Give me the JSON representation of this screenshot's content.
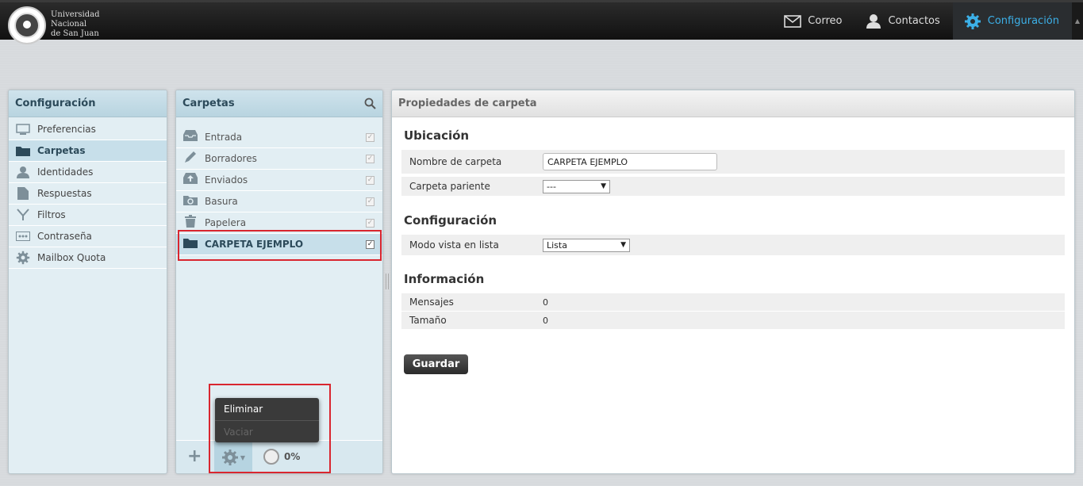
{
  "header": {
    "logo_lines": [
      "Universidad",
      "Nacional",
      "de San Juan"
    ],
    "nav": [
      {
        "label": "Correo",
        "icon": "mail-icon"
      },
      {
        "label": "Contactos",
        "icon": "user-icon"
      },
      {
        "label": "Configuración",
        "icon": "gear-icon",
        "active": true
      }
    ]
  },
  "config_panel": {
    "title": "Configuración",
    "items": [
      {
        "label": "Preferencias",
        "icon": "monitor-icon"
      },
      {
        "label": "Carpetas",
        "icon": "folder-icon",
        "selected": true
      },
      {
        "label": "Identidades",
        "icon": "user-icon"
      },
      {
        "label": "Respuestas",
        "icon": "document-icon"
      },
      {
        "label": "Filtros",
        "icon": "filter-icon"
      },
      {
        "label": "Contraseña",
        "icon": "password-icon"
      },
      {
        "label": "Mailbox Quota",
        "icon": "gear-icon"
      }
    ]
  },
  "folders_panel": {
    "title": "Carpetas",
    "items": [
      {
        "label": "Entrada",
        "icon": "inbox-icon",
        "checked": true
      },
      {
        "label": "Borradores",
        "icon": "pencil-icon",
        "checked": true
      },
      {
        "label": "Enviados",
        "icon": "sent-icon",
        "checked": true
      },
      {
        "label": "Basura",
        "icon": "recycle-icon",
        "checked": true
      },
      {
        "label": "Papelera",
        "icon": "trash-icon",
        "checked": true
      },
      {
        "label": "CARPETA EJEMPLO",
        "icon": "folder-icon",
        "checked": true,
        "selected": true
      }
    ],
    "quota": "0%",
    "popup_menu": [
      {
        "label": "Eliminar",
        "enabled": true
      },
      {
        "label": "Vaciar",
        "enabled": false
      }
    ]
  },
  "properties": {
    "title": "Propiedades de carpeta",
    "section_location": "Ubicación",
    "folder_name_label": "Nombre de carpeta",
    "folder_name_value": "CARPETA EJEMPLO",
    "parent_label": "Carpeta pariente",
    "parent_value": "---",
    "section_config": "Configuración",
    "list_mode_label": "Modo vista en lista",
    "list_mode_value": "Lista",
    "section_info": "Información",
    "messages_label": "Mensajes",
    "messages_value": "0",
    "size_label": "Tamaño",
    "size_value": "0",
    "save_label": "Guardar"
  }
}
